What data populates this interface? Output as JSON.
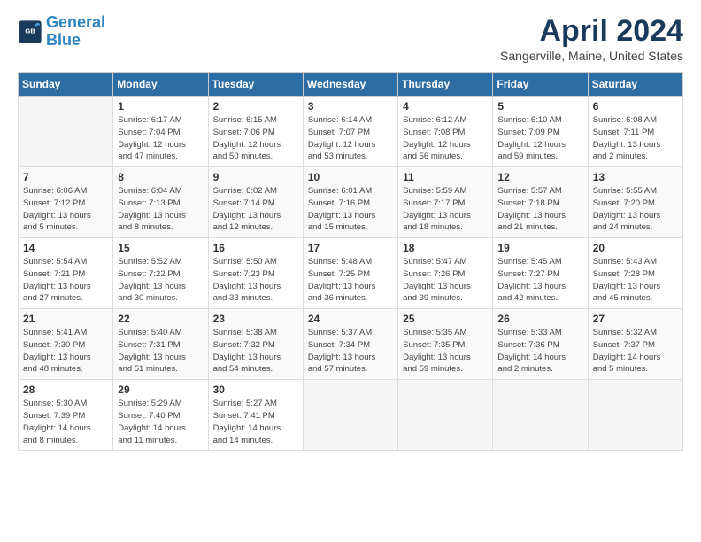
{
  "header": {
    "logo_line1": "General",
    "logo_line2": "Blue",
    "title": "April 2024",
    "location": "Sangerville, Maine, United States"
  },
  "days_of_week": [
    "Sunday",
    "Monday",
    "Tuesday",
    "Wednesday",
    "Thursday",
    "Friday",
    "Saturday"
  ],
  "weeks": [
    [
      {
        "day": "",
        "info": ""
      },
      {
        "day": "1",
        "info": "Sunrise: 6:17 AM\nSunset: 7:04 PM\nDaylight: 12 hours\nand 47 minutes."
      },
      {
        "day": "2",
        "info": "Sunrise: 6:15 AM\nSunset: 7:06 PM\nDaylight: 12 hours\nand 50 minutes."
      },
      {
        "day": "3",
        "info": "Sunrise: 6:14 AM\nSunset: 7:07 PM\nDaylight: 12 hours\nand 53 minutes."
      },
      {
        "day": "4",
        "info": "Sunrise: 6:12 AM\nSunset: 7:08 PM\nDaylight: 12 hours\nand 56 minutes."
      },
      {
        "day": "5",
        "info": "Sunrise: 6:10 AM\nSunset: 7:09 PM\nDaylight: 12 hours\nand 59 minutes."
      },
      {
        "day": "6",
        "info": "Sunrise: 6:08 AM\nSunset: 7:11 PM\nDaylight: 13 hours\nand 2 minutes."
      }
    ],
    [
      {
        "day": "7",
        "info": "Sunrise: 6:06 AM\nSunset: 7:12 PM\nDaylight: 13 hours\nand 5 minutes."
      },
      {
        "day": "8",
        "info": "Sunrise: 6:04 AM\nSunset: 7:13 PM\nDaylight: 13 hours\nand 8 minutes."
      },
      {
        "day": "9",
        "info": "Sunrise: 6:02 AM\nSunset: 7:14 PM\nDaylight: 13 hours\nand 12 minutes."
      },
      {
        "day": "10",
        "info": "Sunrise: 6:01 AM\nSunset: 7:16 PM\nDaylight: 13 hours\nand 15 minutes."
      },
      {
        "day": "11",
        "info": "Sunrise: 5:59 AM\nSunset: 7:17 PM\nDaylight: 13 hours\nand 18 minutes."
      },
      {
        "day": "12",
        "info": "Sunrise: 5:57 AM\nSunset: 7:18 PM\nDaylight: 13 hours\nand 21 minutes."
      },
      {
        "day": "13",
        "info": "Sunrise: 5:55 AM\nSunset: 7:20 PM\nDaylight: 13 hours\nand 24 minutes."
      }
    ],
    [
      {
        "day": "14",
        "info": "Sunrise: 5:54 AM\nSunset: 7:21 PM\nDaylight: 13 hours\nand 27 minutes."
      },
      {
        "day": "15",
        "info": "Sunrise: 5:52 AM\nSunset: 7:22 PM\nDaylight: 13 hours\nand 30 minutes."
      },
      {
        "day": "16",
        "info": "Sunrise: 5:50 AM\nSunset: 7:23 PM\nDaylight: 13 hours\nand 33 minutes."
      },
      {
        "day": "17",
        "info": "Sunrise: 5:48 AM\nSunset: 7:25 PM\nDaylight: 13 hours\nand 36 minutes."
      },
      {
        "day": "18",
        "info": "Sunrise: 5:47 AM\nSunset: 7:26 PM\nDaylight: 13 hours\nand 39 minutes."
      },
      {
        "day": "19",
        "info": "Sunrise: 5:45 AM\nSunset: 7:27 PM\nDaylight: 13 hours\nand 42 minutes."
      },
      {
        "day": "20",
        "info": "Sunrise: 5:43 AM\nSunset: 7:28 PM\nDaylight: 13 hours\nand 45 minutes."
      }
    ],
    [
      {
        "day": "21",
        "info": "Sunrise: 5:41 AM\nSunset: 7:30 PM\nDaylight: 13 hours\nand 48 minutes."
      },
      {
        "day": "22",
        "info": "Sunrise: 5:40 AM\nSunset: 7:31 PM\nDaylight: 13 hours\nand 51 minutes."
      },
      {
        "day": "23",
        "info": "Sunrise: 5:38 AM\nSunset: 7:32 PM\nDaylight: 13 hours\nand 54 minutes."
      },
      {
        "day": "24",
        "info": "Sunrise: 5:37 AM\nSunset: 7:34 PM\nDaylight: 13 hours\nand 57 minutes."
      },
      {
        "day": "25",
        "info": "Sunrise: 5:35 AM\nSunset: 7:35 PM\nDaylight: 13 hours\nand 59 minutes."
      },
      {
        "day": "26",
        "info": "Sunrise: 5:33 AM\nSunset: 7:36 PM\nDaylight: 14 hours\nand 2 minutes."
      },
      {
        "day": "27",
        "info": "Sunrise: 5:32 AM\nSunset: 7:37 PM\nDaylight: 14 hours\nand 5 minutes."
      }
    ],
    [
      {
        "day": "28",
        "info": "Sunrise: 5:30 AM\nSunset: 7:39 PM\nDaylight: 14 hours\nand 8 minutes."
      },
      {
        "day": "29",
        "info": "Sunrise: 5:29 AM\nSunset: 7:40 PM\nDaylight: 14 hours\nand 11 minutes."
      },
      {
        "day": "30",
        "info": "Sunrise: 5:27 AM\nSunset: 7:41 PM\nDaylight: 14 hours\nand 14 minutes."
      },
      {
        "day": "",
        "info": ""
      },
      {
        "day": "",
        "info": ""
      },
      {
        "day": "",
        "info": ""
      },
      {
        "day": "",
        "info": ""
      }
    ]
  ]
}
